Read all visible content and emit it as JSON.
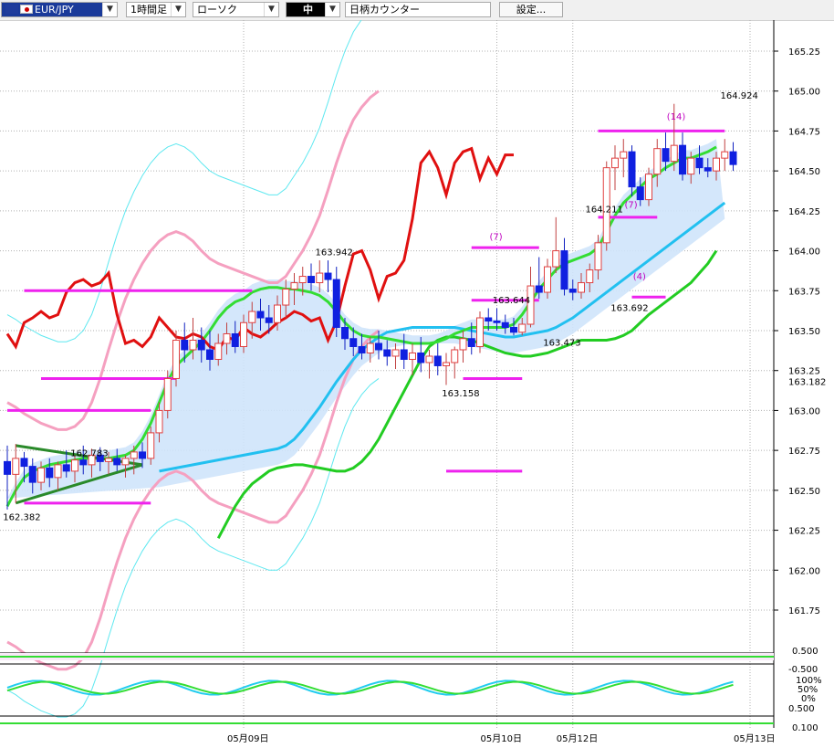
{
  "toolbar": {
    "symbol": "EUR/JPY",
    "timeframe": "1時間足",
    "chart_type": "ローソク",
    "size": "中",
    "counter": "日柄カウンター",
    "settings": "設定..."
  },
  "chart_data": {
    "type": "candlestick",
    "instrument": "EUR/JPY",
    "timeframe": "1時間足",
    "ylim": [
      161.5,
      165.5
    ],
    "y_ticks": [
      "165.25",
      "165.00",
      "164.75",
      "164.50",
      "164.25",
      "164.00",
      "163.75",
      "163.50",
      "163.25",
      "163.00",
      "162.75",
      "162.50",
      "162.25",
      "162.00",
      "161.75"
    ],
    "current_price_label": "163.182",
    "x_date_labels": [
      {
        "label": "05月09日",
        "index": 28
      },
      {
        "label": "05月10日",
        "index": 58
      },
      {
        "label": "05月12日",
        "index": 67
      },
      {
        "label": "05月13日",
        "index": 88
      }
    ],
    "price_annotations": [
      {
        "text": "162.783",
        "index": 9,
        "value": 162.783
      },
      {
        "text": "162.382",
        "index": 1,
        "value": 162.382
      },
      {
        "text": "163.942",
        "index": 38,
        "value": 163.942
      },
      {
        "text": "163.644",
        "index": 59,
        "value": 163.644
      },
      {
        "text": "163.473",
        "index": 65,
        "value": 163.473
      },
      {
        "text": "163.158",
        "index": 53,
        "value": 163.158
      },
      {
        "text": "164.211",
        "index": 70,
        "value": 164.211
      },
      {
        "text": "163.692",
        "index": 73,
        "value": 163.692
      },
      {
        "text": "164.924",
        "index": 86,
        "value": 164.924
      }
    ],
    "count_labels": [
      {
        "text": "(7)",
        "index": 58,
        "value": 164.07
      },
      {
        "text": "(7)",
        "index": 74,
        "value": 164.27
      },
      {
        "text": "(4)",
        "index": 75,
        "value": 163.82
      },
      {
        "text": "(14)",
        "index": 79,
        "value": 164.82
      }
    ],
    "horizontal_levels": [
      {
        "value": 163.75,
        "from": 2,
        "to": 29
      },
      {
        "value": 163.2,
        "from": 4,
        "to": 20
      },
      {
        "value": 163.0,
        "from": 0,
        "to": 17
      },
      {
        "value": 162.42,
        "from": 2,
        "to": 17
      },
      {
        "value": 164.02,
        "from": 55,
        "to": 63
      },
      {
        "value": 163.69,
        "from": 55,
        "to": 63
      },
      {
        "value": 163.2,
        "from": 54,
        "to": 61
      },
      {
        "value": 162.62,
        "from": 52,
        "to": 61
      },
      {
        "value": 164.21,
        "from": 70,
        "to": 77
      },
      {
        "value": 163.71,
        "from": 74,
        "to": 78
      },
      {
        "value": 164.75,
        "from": 70,
        "to": 85
      }
    ],
    "candles": [
      {
        "o": 162.68,
        "h": 162.78,
        "l": 162.38,
        "c": 162.6
      },
      {
        "o": 162.6,
        "h": 162.79,
        "l": 162.42,
        "c": 162.7
      },
      {
        "o": 162.7,
        "h": 162.74,
        "l": 162.55,
        "c": 162.65
      },
      {
        "o": 162.65,
        "h": 162.7,
        "l": 162.48,
        "c": 162.55
      },
      {
        "o": 162.55,
        "h": 162.68,
        "l": 162.5,
        "c": 162.64
      },
      {
        "o": 162.64,
        "h": 162.7,
        "l": 162.52,
        "c": 162.58
      },
      {
        "o": 162.58,
        "h": 162.68,
        "l": 162.5,
        "c": 162.66
      },
      {
        "o": 162.66,
        "h": 162.75,
        "l": 162.58,
        "c": 162.62
      },
      {
        "o": 162.62,
        "h": 162.72,
        "l": 162.55,
        "c": 162.69
      },
      {
        "o": 162.69,
        "h": 162.78,
        "l": 162.6,
        "c": 162.66
      },
      {
        "o": 162.66,
        "h": 162.76,
        "l": 162.58,
        "c": 162.72
      },
      {
        "o": 162.72,
        "h": 162.77,
        "l": 162.62,
        "c": 162.68
      },
      {
        "o": 162.68,
        "h": 162.74,
        "l": 162.6,
        "c": 162.7
      },
      {
        "o": 162.7,
        "h": 162.76,
        "l": 162.62,
        "c": 162.66
      },
      {
        "o": 162.66,
        "h": 162.72,
        "l": 162.58,
        "c": 162.7
      },
      {
        "o": 162.7,
        "h": 162.78,
        "l": 162.6,
        "c": 162.74
      },
      {
        "o": 162.74,
        "h": 162.8,
        "l": 162.64,
        "c": 162.7
      },
      {
        "o": 162.7,
        "h": 162.9,
        "l": 162.66,
        "c": 162.86
      },
      {
        "o": 162.86,
        "h": 163.05,
        "l": 162.8,
        "c": 163.0
      },
      {
        "o": 163.0,
        "h": 163.25,
        "l": 162.95,
        "c": 163.2
      },
      {
        "o": 163.2,
        "h": 163.5,
        "l": 163.15,
        "c": 163.44
      },
      {
        "o": 163.44,
        "h": 163.55,
        "l": 163.3,
        "c": 163.38
      },
      {
        "o": 163.38,
        "h": 163.58,
        "l": 163.32,
        "c": 163.44
      },
      {
        "o": 163.44,
        "h": 163.52,
        "l": 163.3,
        "c": 163.38
      },
      {
        "o": 163.38,
        "h": 163.5,
        "l": 163.25,
        "c": 163.32
      },
      {
        "o": 163.32,
        "h": 163.48,
        "l": 163.28,
        "c": 163.42
      },
      {
        "o": 163.42,
        "h": 163.55,
        "l": 163.35,
        "c": 163.48
      },
      {
        "o": 163.48,
        "h": 163.56,
        "l": 163.36,
        "c": 163.4
      },
      {
        "o": 163.4,
        "h": 163.6,
        "l": 163.36,
        "c": 163.55
      },
      {
        "o": 163.55,
        "h": 163.68,
        "l": 163.45,
        "c": 163.62
      },
      {
        "o": 163.62,
        "h": 163.7,
        "l": 163.5,
        "c": 163.58
      },
      {
        "o": 163.58,
        "h": 163.66,
        "l": 163.48,
        "c": 163.55
      },
      {
        "o": 163.55,
        "h": 163.72,
        "l": 163.5,
        "c": 163.66
      },
      {
        "o": 163.66,
        "h": 163.82,
        "l": 163.58,
        "c": 163.76
      },
      {
        "o": 163.76,
        "h": 163.86,
        "l": 163.66,
        "c": 163.8
      },
      {
        "o": 163.8,
        "h": 163.9,
        "l": 163.72,
        "c": 163.84
      },
      {
        "o": 163.84,
        "h": 163.92,
        "l": 163.75,
        "c": 163.8
      },
      {
        "o": 163.8,
        "h": 163.94,
        "l": 163.74,
        "c": 163.86
      },
      {
        "o": 163.86,
        "h": 163.94,
        "l": 163.74,
        "c": 163.82
      },
      {
        "o": 163.82,
        "h": 163.9,
        "l": 163.46,
        "c": 163.52
      },
      {
        "o": 163.52,
        "h": 163.58,
        "l": 163.38,
        "c": 163.45
      },
      {
        "o": 163.45,
        "h": 163.52,
        "l": 163.34,
        "c": 163.4
      },
      {
        "o": 163.4,
        "h": 163.48,
        "l": 163.32,
        "c": 163.36
      },
      {
        "o": 163.36,
        "h": 163.46,
        "l": 163.3,
        "c": 163.42
      },
      {
        "o": 163.42,
        "h": 163.5,
        "l": 163.32,
        "c": 163.38
      },
      {
        "o": 163.38,
        "h": 163.44,
        "l": 163.28,
        "c": 163.34
      },
      {
        "o": 163.34,
        "h": 163.42,
        "l": 163.26,
        "c": 163.38
      },
      {
        "o": 163.38,
        "h": 163.48,
        "l": 163.26,
        "c": 163.32
      },
      {
        "o": 163.32,
        "h": 163.42,
        "l": 163.22,
        "c": 163.36
      },
      {
        "o": 163.36,
        "h": 163.46,
        "l": 163.24,
        "c": 163.3
      },
      {
        "o": 163.3,
        "h": 163.38,
        "l": 163.2,
        "c": 163.34
      },
      {
        "o": 163.34,
        "h": 163.42,
        "l": 163.22,
        "c": 163.28
      },
      {
        "o": 163.28,
        "h": 163.36,
        "l": 163.16,
        "c": 163.3
      },
      {
        "o": 163.3,
        "h": 163.4,
        "l": 163.2,
        "c": 163.38
      },
      {
        "o": 163.38,
        "h": 163.5,
        "l": 163.3,
        "c": 163.45
      },
      {
        "o": 163.45,
        "h": 163.55,
        "l": 163.35,
        "c": 163.4
      },
      {
        "o": 163.4,
        "h": 163.62,
        "l": 163.36,
        "c": 163.58
      },
      {
        "o": 163.58,
        "h": 163.64,
        "l": 163.5,
        "c": 163.56
      },
      {
        "o": 163.56,
        "h": 163.64,
        "l": 163.5,
        "c": 163.55
      },
      {
        "o": 163.55,
        "h": 163.6,
        "l": 163.48,
        "c": 163.52
      },
      {
        "o": 163.52,
        "h": 163.58,
        "l": 163.47,
        "c": 163.49
      },
      {
        "o": 163.49,
        "h": 163.58,
        "l": 163.47,
        "c": 163.54
      },
      {
        "o": 163.54,
        "h": 163.9,
        "l": 163.52,
        "c": 163.78
      },
      {
        "o": 163.78,
        "h": 163.96,
        "l": 163.7,
        "c": 163.74
      },
      {
        "o": 163.74,
        "h": 163.95,
        "l": 163.7,
        "c": 163.9
      },
      {
        "o": 163.9,
        "h": 164.21,
        "l": 163.86,
        "c": 164.0
      },
      {
        "o": 164.0,
        "h": 164.08,
        "l": 163.72,
        "c": 163.76
      },
      {
        "o": 163.76,
        "h": 163.82,
        "l": 163.69,
        "c": 163.74
      },
      {
        "o": 163.74,
        "h": 163.86,
        "l": 163.7,
        "c": 163.8
      },
      {
        "o": 163.8,
        "h": 163.92,
        "l": 163.74,
        "c": 163.88
      },
      {
        "o": 163.88,
        "h": 164.1,
        "l": 163.82,
        "c": 164.05
      },
      {
        "o": 164.05,
        "h": 164.56,
        "l": 164.0,
        "c": 164.52
      },
      {
        "o": 164.52,
        "h": 164.66,
        "l": 164.38,
        "c": 164.58
      },
      {
        "o": 164.58,
        "h": 164.7,
        "l": 164.46,
        "c": 164.62
      },
      {
        "o": 164.62,
        "h": 164.66,
        "l": 164.34,
        "c": 164.4
      },
      {
        "o": 164.4,
        "h": 164.46,
        "l": 164.28,
        "c": 164.32
      },
      {
        "o": 164.32,
        "h": 164.52,
        "l": 164.28,
        "c": 164.48
      },
      {
        "o": 164.48,
        "h": 164.7,
        "l": 164.4,
        "c": 164.64
      },
      {
        "o": 164.64,
        "h": 164.74,
        "l": 164.5,
        "c": 164.56
      },
      {
        "o": 164.56,
        "h": 164.92,
        "l": 164.5,
        "c": 164.66
      },
      {
        "o": 164.66,
        "h": 164.74,
        "l": 164.44,
        "c": 164.48
      },
      {
        "o": 164.48,
        "h": 164.62,
        "l": 164.42,
        "c": 164.58
      },
      {
        "o": 164.58,
        "h": 164.66,
        "l": 164.48,
        "c": 164.52
      },
      {
        "o": 164.52,
        "h": 164.58,
        "l": 164.46,
        "c": 164.5
      },
      {
        "o": 164.5,
        "h": 164.62,
        "l": 164.44,
        "c": 164.58
      },
      {
        "o": 164.58,
        "h": 164.7,
        "l": 164.5,
        "c": 164.62
      },
      {
        "o": 164.62,
        "h": 164.68,
        "l": 164.5,
        "c": 164.54
      }
    ],
    "lines": {
      "chikou_red": [
        163.48,
        163.4,
        163.55,
        163.58,
        163.62,
        163.58,
        163.6,
        163.74,
        163.8,
        163.82,
        163.78,
        163.8,
        163.86,
        163.6,
        163.42,
        163.44,
        163.4,
        163.46,
        163.58,
        163.52,
        163.46,
        163.45,
        163.48,
        163.46,
        163.4,
        163.38,
        163.46,
        163.44,
        163.52,
        163.48,
        163.46,
        163.5,
        163.55,
        163.58,
        163.62,
        163.6,
        163.56,
        163.58,
        163.44,
        163.56,
        163.78,
        163.98,
        164.0,
        163.88,
        163.7,
        163.84,
        163.86,
        163.94,
        164.2,
        164.55,
        164.62,
        164.52,
        164.35,
        164.55,
        164.62,
        164.64,
        164.45,
        164.58,
        164.48,
        164.6,
        164.6
      ],
      "chikou_start": 0,
      "tenkan_green": [
        162.4,
        162.5,
        162.58,
        162.62,
        162.64,
        162.66,
        162.67,
        162.68,
        162.69,
        162.7,
        162.7,
        162.7,
        162.7,
        162.71,
        162.72,
        162.75,
        162.82,
        162.92,
        163.05,
        163.18,
        163.28,
        163.33,
        163.38,
        163.43,
        163.5,
        163.58,
        163.64,
        163.68,
        163.7,
        163.74,
        163.76,
        163.77,
        163.77,
        163.76,
        163.76,
        163.75,
        163.74,
        163.72,
        163.68,
        163.62,
        163.55,
        163.5,
        163.47,
        163.46,
        163.46,
        163.45,
        163.44,
        163.43,
        163.42,
        163.42,
        163.42,
        163.43,
        163.45,
        163.48,
        163.5,
        163.52,
        163.52,
        163.52,
        163.52,
        163.52,
        163.54,
        163.6,
        163.68,
        163.76,
        163.82,
        163.88,
        163.92,
        163.94,
        163.96,
        163.98,
        164.02,
        164.12,
        164.22,
        164.3,
        164.35,
        164.4,
        164.45,
        164.48,
        164.52,
        164.55,
        164.58,
        164.58,
        164.6,
        164.62,
        164.65
      ],
      "kijun_cyan": [
        162.62,
        162.63,
        162.64,
        162.65,
        162.66,
        162.67,
        162.68,
        162.69,
        162.7,
        162.71,
        162.72,
        162.73,
        162.74,
        162.75,
        162.76,
        162.78,
        162.82,
        162.88,
        162.95,
        163.02,
        163.1,
        163.18,
        163.25,
        163.32,
        163.38,
        163.42,
        163.46,
        163.49,
        163.5,
        163.51,
        163.52,
        163.52,
        163.52,
        163.52,
        163.52,
        163.52,
        163.51,
        163.5,
        163.49,
        163.48,
        163.47,
        163.46,
        163.46,
        163.47,
        163.48,
        163.49,
        163.5,
        163.52,
        163.55,
        163.58,
        163.62,
        163.66,
        163.7,
        163.74,
        163.78,
        163.82,
        163.86,
        163.9,
        163.94,
        163.98,
        164.02,
        164.06,
        164.1,
        164.14,
        164.18,
        164.22,
        164.26,
        164.3
      ],
      "kijun_start": 18,
      "ma_green_slow": [
        162.2,
        162.3,
        162.4,
        162.48,
        162.54,
        162.58,
        162.62,
        162.64,
        162.65,
        162.66,
        162.66,
        162.65,
        162.64,
        162.63,
        162.62,
        162.62,
        162.64,
        162.68,
        162.74,
        162.82,
        162.92,
        163.02,
        163.12,
        163.22,
        163.32,
        163.4,
        163.44,
        163.46,
        163.46,
        163.45,
        163.44,
        163.42,
        163.4,
        163.38,
        163.36,
        163.35,
        163.34,
        163.34,
        163.35,
        163.36,
        163.38,
        163.4,
        163.42,
        163.44,
        163.44,
        163.44,
        163.44,
        163.45,
        163.47,
        163.5,
        163.55,
        163.6,
        163.64,
        163.68,
        163.72,
        163.76,
        163.8,
        163.86,
        163.92,
        164.0
      ],
      "ma_green_slow_start": 25,
      "bb_pink_upper": [
        163.05,
        163.02,
        162.98,
        162.95,
        162.92,
        162.9,
        162.88,
        162.88,
        162.9,
        162.95,
        163.05,
        163.2,
        163.38,
        163.55,
        163.7,
        163.82,
        163.92,
        164.0,
        164.06,
        164.1,
        164.12,
        164.1,
        164.06,
        164.0,
        163.95,
        163.92,
        163.9,
        163.88,
        163.86,
        163.84,
        163.82,
        163.8,
        163.8,
        163.84,
        163.92,
        164.0,
        164.1,
        164.22,
        164.38,
        164.55,
        164.7,
        164.82,
        164.9,
        164.96,
        165.0
      ],
      "bb_pink_upper_start": 0
    },
    "oscillators": [
      {
        "panel": "upper",
        "ticks": [
          "0.500",
          "-0.500"
        ]
      },
      {
        "panel": "lower",
        "ticks": [
          "100%",
          "50%",
          "0%"
        ]
      },
      {
        "panel": "bottom",
        "ticks": [
          "0.500",
          "0.100"
        ]
      }
    ]
  }
}
